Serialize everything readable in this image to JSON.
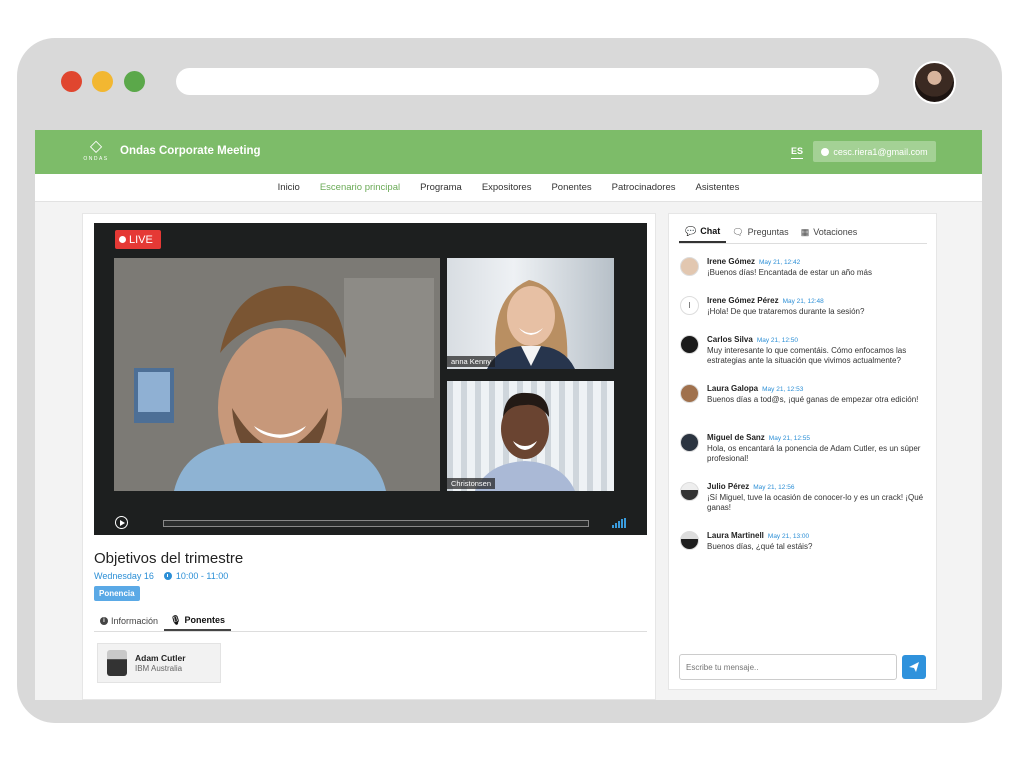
{
  "app": {
    "title": "Ondas Corporate Meeting",
    "logo_text": "ONDAS",
    "lang": "ES",
    "user_email": "cesc.riera1@gmail.com"
  },
  "nav": [
    {
      "label": "Inicio",
      "active": false
    },
    {
      "label": "Escenario principal",
      "active": true
    },
    {
      "label": "Programa",
      "active": false
    },
    {
      "label": "Expositores",
      "active": false
    },
    {
      "label": "Ponentes",
      "active": false
    },
    {
      "label": "Patrocinadores",
      "active": false
    },
    {
      "label": "Asistentes",
      "active": false
    }
  ],
  "video": {
    "live_label": "LIVE",
    "participants": [
      {
        "name": "anna Kenny"
      },
      {
        "name": "Christonsen"
      }
    ]
  },
  "session": {
    "title": "Objetivos del trimestre",
    "date": "Wednesday 16",
    "time": "10:00 - 11:00",
    "tag": "Ponencia",
    "tabs": [
      {
        "label": "Información"
      },
      {
        "label": "Ponentes"
      }
    ],
    "speaker": {
      "name": "Adam Cutler",
      "org": "IBM Australia"
    }
  },
  "chat": {
    "tabs": [
      {
        "label": "Chat"
      },
      {
        "label": "Preguntas"
      },
      {
        "label": "Votaciones"
      }
    ],
    "messages": [
      {
        "author": "Irene Gómez",
        "time": "May 21, 12:42",
        "text": "¡Buenos días! Encantada de estar un año más"
      },
      {
        "author": "Irene Gómez Pérez",
        "time": "May 21, 12:48",
        "text": "¡Hola! De que trataremos durante la sesión?"
      },
      {
        "author": "Carlos Silva",
        "time": "May 21, 12:50",
        "text": "Muy interesante lo que comentáis. Cómo enfocamos las estrategias ante la situación que vivimos actualmente?"
      },
      {
        "author": "Laura Galopa",
        "time": "May 21, 12:53",
        "text": "Buenos días a tod@s, ¡qué ganas de empezar otra edición!"
      },
      {
        "author": "Miguel de Sanz",
        "time": "May 21, 12:55",
        "text": "Hola, os encantará la ponencia de Adam Cutler, es un súper profesional!"
      },
      {
        "author": "Julio Pérez",
        "time": "May 21, 12:56",
        "text": "¡Sí Miguel, tuve la ocasión de conocer-lo y es un crack! ¡Qué ganas!"
      },
      {
        "author": "Laura Martinell",
        "time": "May 21, 13:00",
        "text": "Buenos días, ¿qué tal estáis?"
      }
    ],
    "input_placeholder": "Escribe tu mensaje.."
  },
  "colors": {
    "brand_green": "#7dbc69",
    "accent_blue": "#2f92dc",
    "live_red": "#e53935"
  }
}
